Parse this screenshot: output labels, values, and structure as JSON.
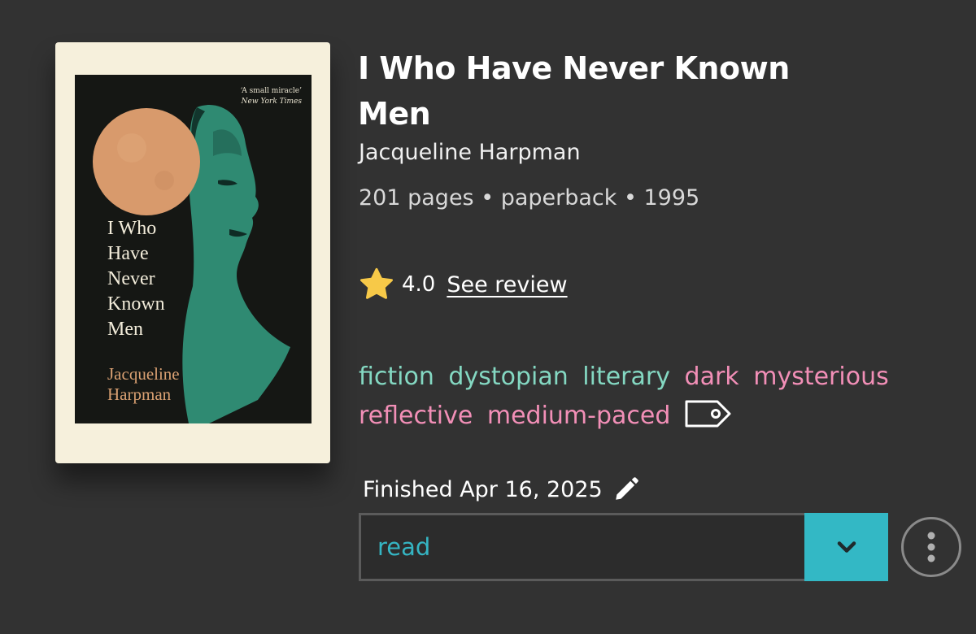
{
  "book": {
    "title": "I Who Have Never Known Men",
    "author": "Jacqueline Harpman",
    "meta": "201 pages • paperback • 1995"
  },
  "cover": {
    "quote": "‘A small miracle’",
    "quote_source": "New York Times",
    "title": "I Who\nHave\nNever\nKnown\nMen",
    "author": "Jacqueline\nHarpman",
    "colors": {
      "frame": "#f6f0dc",
      "background": "#151714",
      "moon": "#d89a6c",
      "face": "#2f8a72",
      "author_text": "#d9a072"
    }
  },
  "rating": {
    "value": "4.0",
    "link_label": "See review",
    "icon": "star-icon"
  },
  "tags": {
    "genres": [
      "fiction",
      "dystopian",
      "literary"
    ],
    "moods": [
      "dark",
      "mysterious",
      "reflective",
      "medium-paced"
    ],
    "icon": "tag-icon"
  },
  "finished": {
    "label": "Finished Apr 16, 2025",
    "icon": "pencil-icon"
  },
  "status": {
    "selected": "read",
    "icon": "chevron-down-icon"
  },
  "more": {
    "icon": "more-vertical-icon"
  },
  "colors": {
    "background": "#323232",
    "accent": "#33b8c5",
    "genre_tag": "#84d8c2",
    "mood_tag": "#f28fb7",
    "star": "#f7c948"
  }
}
